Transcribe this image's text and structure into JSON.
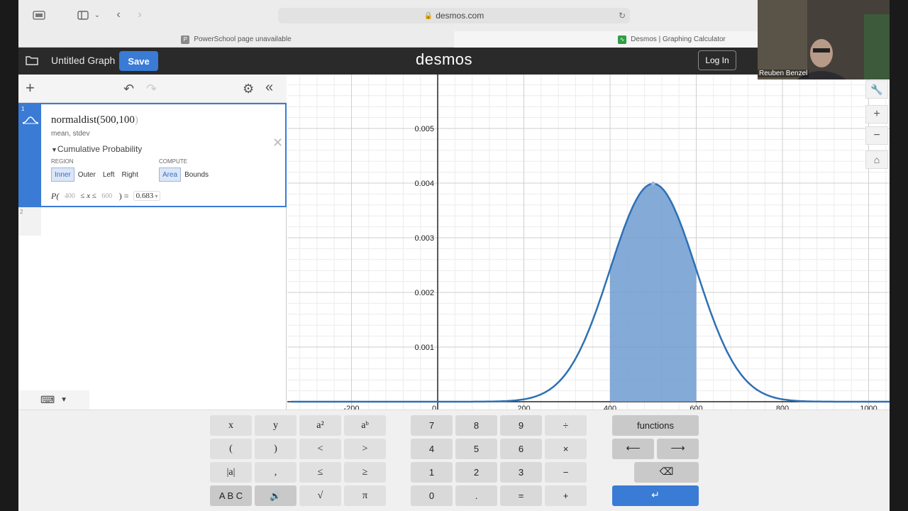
{
  "browser": {
    "url": "desmos.com",
    "tabs": [
      {
        "label": "PowerSchool page unavailable",
        "favicon_color": "#8a8a8a"
      },
      {
        "label": "Desmos | Graphing Calculator",
        "favicon_color": "#2f9e44"
      }
    ]
  },
  "header": {
    "graph_title": "Untitled Graph",
    "save_label": "Save",
    "logo": "desmos",
    "login_label": "Log In"
  },
  "expressions": [
    {
      "index": "1",
      "formula": "normaldist(500,100",
      "formula_close": ")",
      "hint": "mean, stdev",
      "cumulative_label": "Cumulative Probability",
      "region_label": "REGION",
      "region_options": [
        "Inner",
        "Outer",
        "Left",
        "Right"
      ],
      "region_selected": "Inner",
      "compute_label": "COMPUTE",
      "compute_options": [
        "Area",
        "Bounds"
      ],
      "compute_selected": "Area",
      "prob_prefix": "P(",
      "prob_lower": "400",
      "prob_middle": "≤ x ≤",
      "prob_upper": "600",
      "prob_suffix": ") =",
      "prob_result": "0.683"
    },
    {
      "index": "2"
    }
  ],
  "graph": {
    "x_ticks": [
      -200,
      0,
      200,
      400,
      600,
      800,
      1000
    ],
    "y_ticks": [
      0.001,
      0.002,
      0.003,
      0.004,
      0.005
    ],
    "mean": 500,
    "stdev": 100,
    "shade_from": 400,
    "shade_to": 600,
    "curve_color": "#2d70b3",
    "shade_color": "#6f9bd1"
  },
  "keypad": {
    "left": [
      [
        "x",
        "y",
        "a²",
        "aᵇ"
      ],
      [
        "(",
        ")",
        "<",
        ">"
      ],
      [
        "|a|",
        ",",
        "≤",
        "≥"
      ],
      [
        "A B C",
        "🔊",
        "√",
        "π"
      ]
    ],
    "numbers": [
      [
        "7",
        "8",
        "9",
        "÷"
      ],
      [
        "4",
        "5",
        "6",
        "×"
      ],
      [
        "1",
        "2",
        "3",
        "−"
      ],
      [
        "0",
        ".",
        "=",
        "+"
      ]
    ],
    "functions_label": "functions",
    "left_arrow": "⟵",
    "right_arrow": "⟶",
    "backspace": "⌫",
    "enter": "↵"
  },
  "video": {
    "participant_name": "Reuben Benzel"
  }
}
